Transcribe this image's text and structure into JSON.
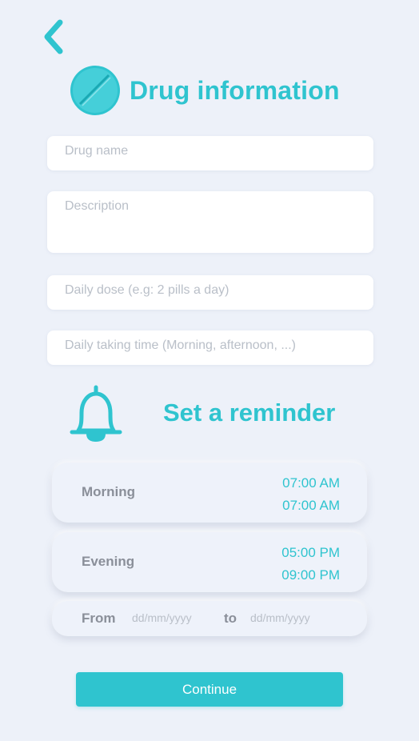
{
  "header": {
    "back_icon": "chevron-left-icon",
    "pill_icon": "pill-icon",
    "title": "Drug information"
  },
  "form": {
    "drug_name_placeholder": "Drug name",
    "description_placeholder": "Description",
    "daily_dose_placeholder": "Daily dose (e.g: 2 pills a day)",
    "daily_time_placeholder": "Daily taking time (Morning, afternoon, ...)"
  },
  "reminder": {
    "icon": "bell-icon",
    "title": "Set a reminder",
    "morning": {
      "label": "Morning",
      "times": [
        "07:00 AM",
        "07:00 AM"
      ]
    },
    "evening": {
      "label": "Evening",
      "times": [
        "05:00 PM",
        "09:00 PM"
      ]
    },
    "range": {
      "from_label": "From",
      "from_placeholder": "dd/mm/yyyy",
      "to_label": "to",
      "to_placeholder": "dd/mm/yyyy"
    }
  },
  "continue_label": "Continue",
  "colors": {
    "accent": "#2fc4cf",
    "background": "#edf1f9",
    "muted_text": "#8a8f99"
  }
}
